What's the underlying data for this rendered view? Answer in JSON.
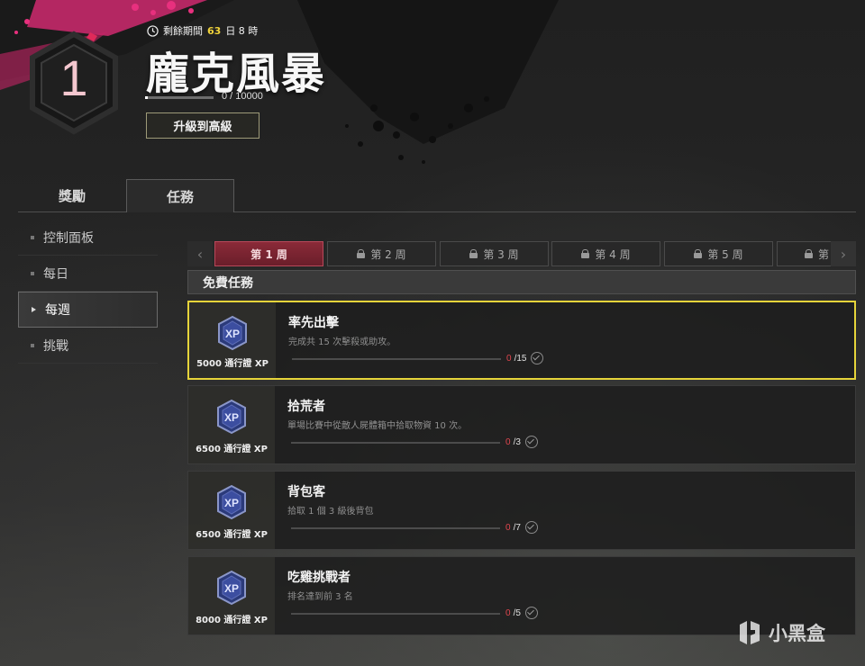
{
  "header": {
    "level": "1",
    "timer_prefix": "剩餘期間",
    "timer_days": "63",
    "timer_suffix": "日 8 時",
    "title": "龐克風暴",
    "xp_progress": "0 / 10000",
    "xp_fraction": 0,
    "upgrade_label": "升級到高級"
  },
  "tabs": [
    {
      "label": "獎勵"
    },
    {
      "label": "任務",
      "active": true
    }
  ],
  "sidebar": {
    "items": [
      {
        "label": "控制面板"
      },
      {
        "label": "每日"
      },
      {
        "label": "每週",
        "active": true
      },
      {
        "label": "挑戰"
      }
    ]
  },
  "weeks": {
    "items": [
      {
        "label": "第 1 周",
        "active": true
      },
      {
        "label": "第 2 周",
        "locked": true
      },
      {
        "label": "第 3 周",
        "locked": true
      },
      {
        "label": "第 4 周",
        "locked": true
      },
      {
        "label": "第 5 周",
        "locked": true
      },
      {
        "label": "第",
        "locked": true
      }
    ],
    "prev_icon": "chevron-left-icon",
    "next_icon": "chevron-right-icon"
  },
  "section": {
    "title": "免費任務"
  },
  "missions": [
    {
      "xp": "5000 通行證 XP",
      "title": "率先出擊",
      "desc": "完成共 15 次擊殺或助攻。",
      "current": "0",
      "total": "/15",
      "selected": true
    },
    {
      "xp": "6500 通行證 XP",
      "title": "拾荒者",
      "desc": "單場比賽中從敵人屍體箱中拾取物資 10 次。",
      "current": "0",
      "total": "/3"
    },
    {
      "xp": "6500 通行證 XP",
      "title": "背包客",
      "desc": "拾取 1 個 3 級後背包",
      "current": "0",
      "total": "/7"
    },
    {
      "xp": "8000 通行證 XP",
      "title": "吃雞挑戰者",
      "desc": "排名達到前 3 名",
      "current": "0",
      "total": "/5"
    }
  ],
  "watermark": "小黑盒",
  "colors": {
    "accent_yellow": "#e6d43a",
    "active_week": "#8a2a38",
    "progress_zero": "#e0464e",
    "splash_pink": "#e02a78"
  }
}
